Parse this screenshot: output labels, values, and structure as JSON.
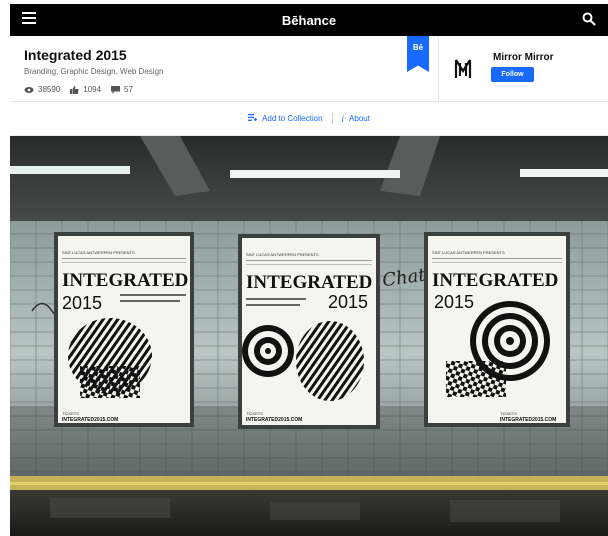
{
  "header": {
    "brand": "Bēhance"
  },
  "project": {
    "title": "Integrated 2015",
    "fields": "Branding, Graphic Design, Web Design",
    "views": "38590",
    "appreciations": "1094",
    "comments": "57"
  },
  "badge": {
    "label": "Bē"
  },
  "owner": {
    "name": "Mirror Mirror",
    "follow_label": "Follow"
  },
  "actions": {
    "add_to_collection": "Add to Collection",
    "about": "About"
  },
  "posters": [
    {
      "presenter": "SINT LUCAS ANTWERPEN PRESENTS",
      "title": "INTEGRATED",
      "year": "2015",
      "tickets": "TICKETS",
      "url": "INTEGRATED2015.COM"
    },
    {
      "presenter": "SINT LUCAS ANTWERPEN PRESENTS",
      "title": "INTEGRATED",
      "year": "2015",
      "tickets": "TICKETS",
      "url": "INTEGRATED2015.COM"
    },
    {
      "presenter": "SINT LUCAS ANTWERPEN PRESENTS",
      "title": "INTEGRATED",
      "year": "2015",
      "tickets": "TICKETS",
      "url": "INTEGRATED2015.COM"
    }
  ],
  "colors": {
    "accent": "#1769ff",
    "topbar": "#000000"
  }
}
